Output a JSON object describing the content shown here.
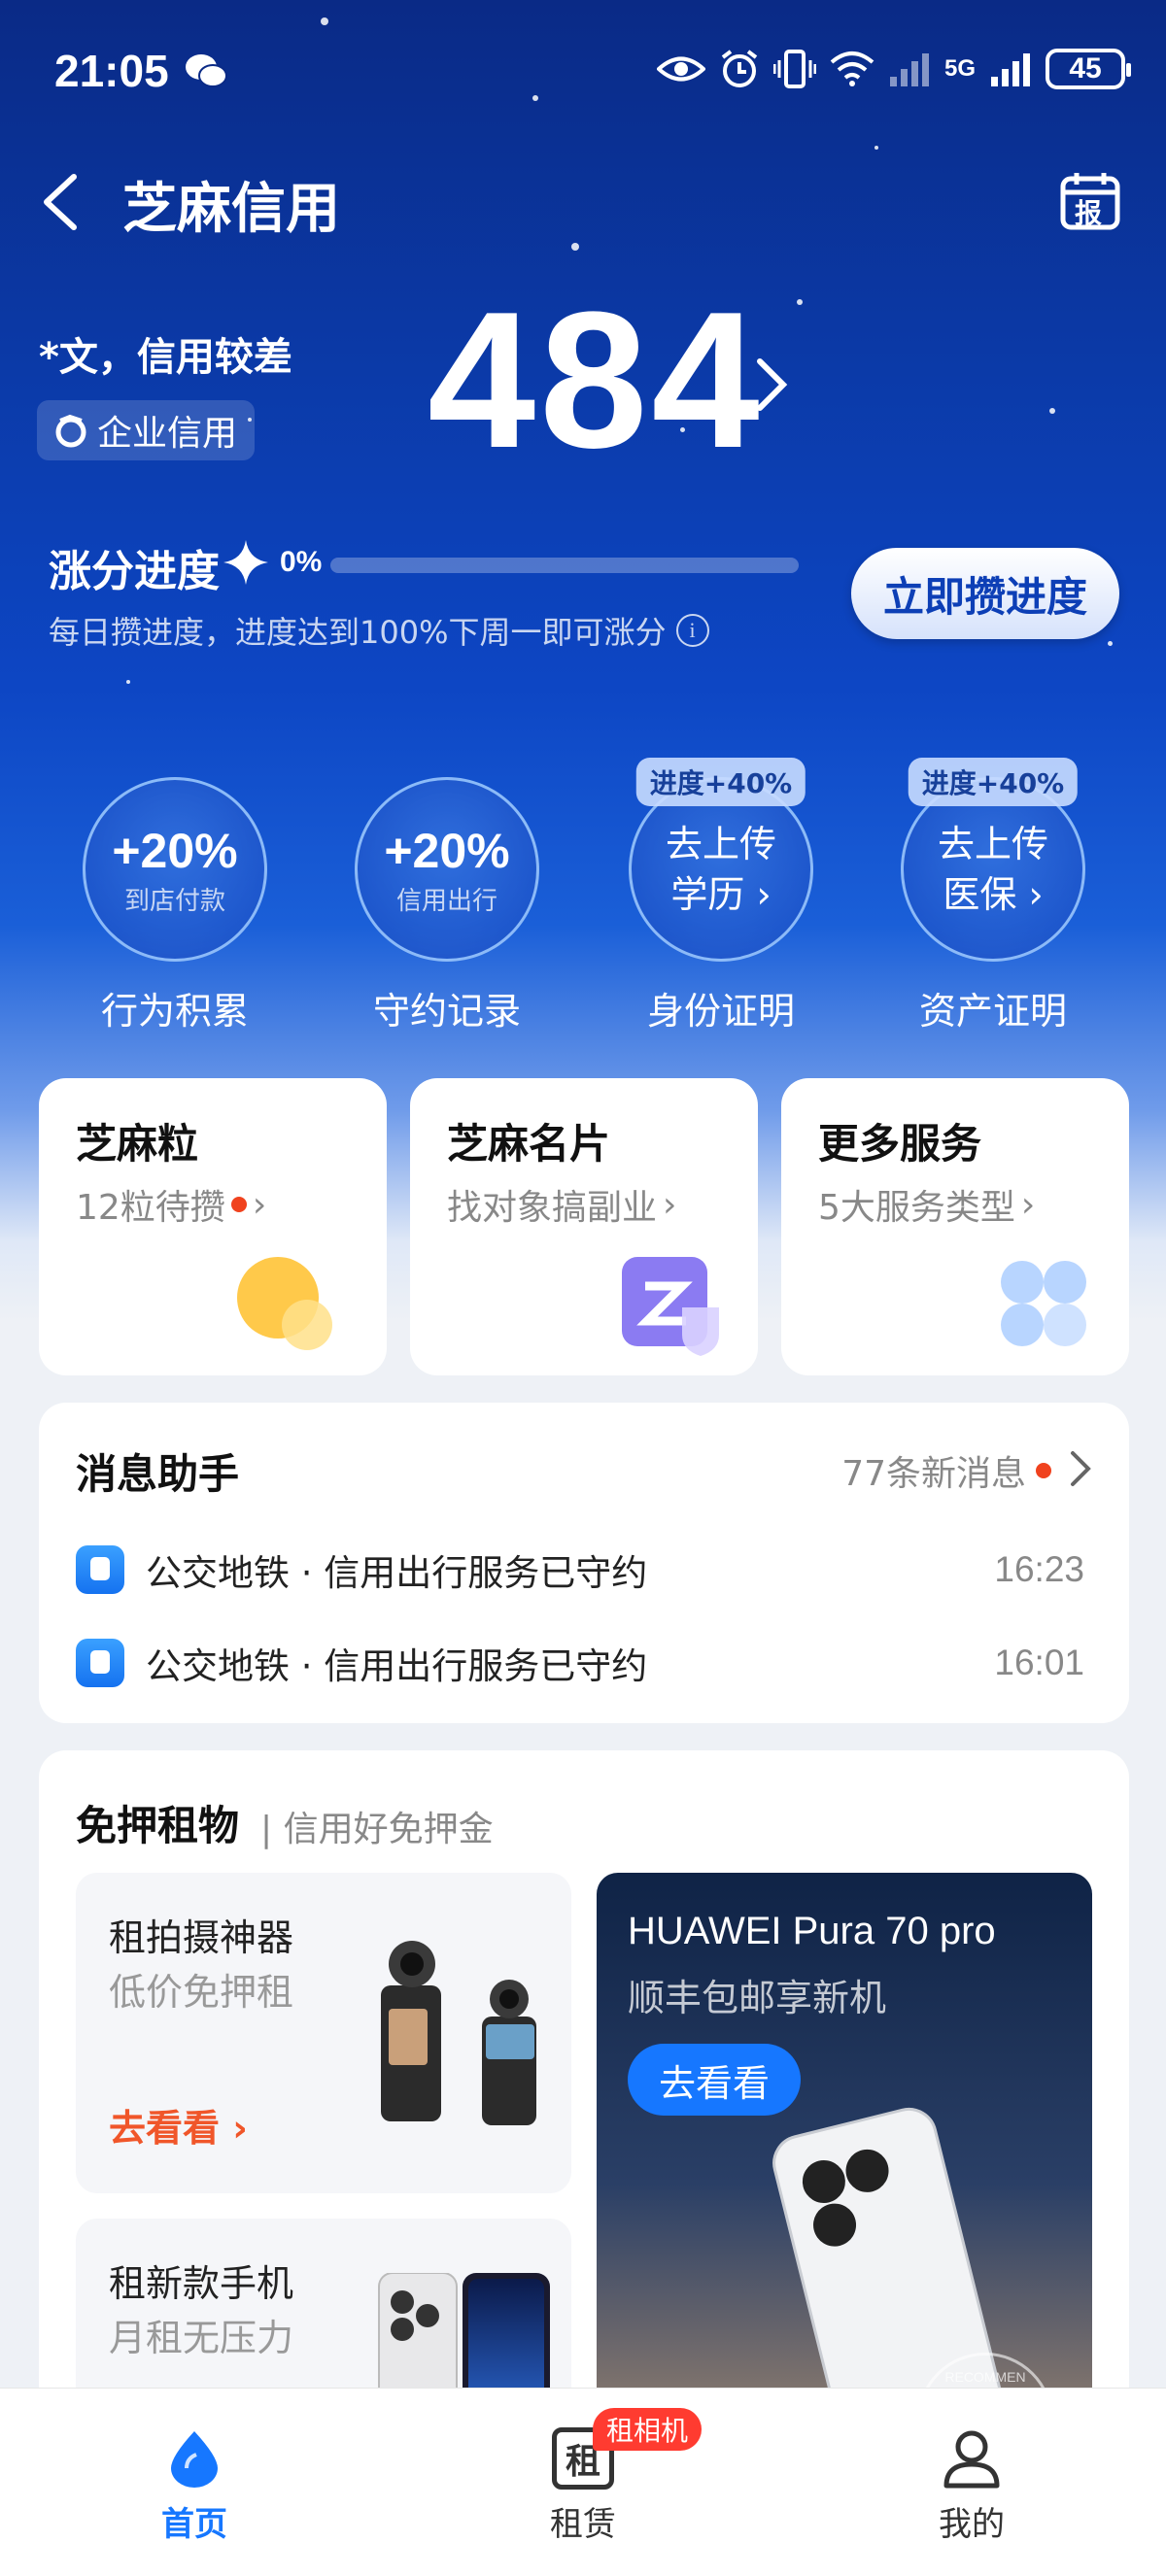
{
  "status_bar": {
    "time": "21:05",
    "network": "5G",
    "battery": "45"
  },
  "header": {
    "title": "芝麻信用",
    "calendar_label": "报"
  },
  "user": {
    "description": "*文，信用较差",
    "enterprise_label": "企业信用"
  },
  "score": "484",
  "progress": {
    "label": "涨分进度",
    "percent_text": "0%",
    "percent_value": 0,
    "subtitle": "每日攒进度，进度达到100%下周一即可涨分",
    "cta": "立即攒进度"
  },
  "categories": [
    {
      "big": "+20%",
      "small": "到店付款",
      "label": "行为积累"
    },
    {
      "big": "+20%",
      "small": "信用出行",
      "label": "守约记录"
    },
    {
      "pill": "进度+40%",
      "line1": "去上传",
      "line2": "学历 ›",
      "label": "身份证明"
    },
    {
      "pill": "进度+40%",
      "line1": "去上传",
      "line2": "医保 ›",
      "label": "资产证明"
    }
  ],
  "quick_cards": [
    {
      "title": "芝麻粒",
      "subtitle": "12粒待攒",
      "icon": "sesame-grain-icon"
    },
    {
      "title": "芝麻名片",
      "subtitle": "找对象搞副业",
      "icon": "name-card-icon"
    },
    {
      "title": "更多服务",
      "subtitle": "5大服务类型",
      "icon": "clover-icon"
    }
  ],
  "messages": {
    "title": "消息助手",
    "count_text": "77条新消息",
    "items": [
      {
        "text": "公交地铁 · 信用出行服务已守约",
        "time": "16:23"
      },
      {
        "text": "公交地铁 · 信用出行服务已守约",
        "time": "16:01"
      }
    ]
  },
  "rental": {
    "title": "免押租物",
    "subtitle": "| 信用好免押金",
    "items": [
      {
        "title": "租拍摄神器",
        "subtitle": "低价免押租",
        "link": "去看看 ›"
      },
      {
        "title": "租新款手机",
        "subtitle": "月租无压力"
      }
    ],
    "promo": {
      "title": "HUAWEI Pura 70 pro",
      "subtitle": "顺丰包邮享新机",
      "button": "去看看",
      "stamp": "RECOMMEN"
    }
  },
  "tabbar": {
    "items": [
      {
        "label": "首页",
        "active": true,
        "icon": "home-drop-icon"
      },
      {
        "label": "租赁",
        "active": false,
        "icon": "rent-icon",
        "icon_char": "租",
        "badge": "租相机"
      },
      {
        "label": "我的",
        "active": false,
        "icon": "profile-icon"
      }
    ]
  },
  "colors": {
    "brand_blue": "#1677ff",
    "accent_orange": "#f0562a",
    "badge_red": "#ff3b30"
  }
}
